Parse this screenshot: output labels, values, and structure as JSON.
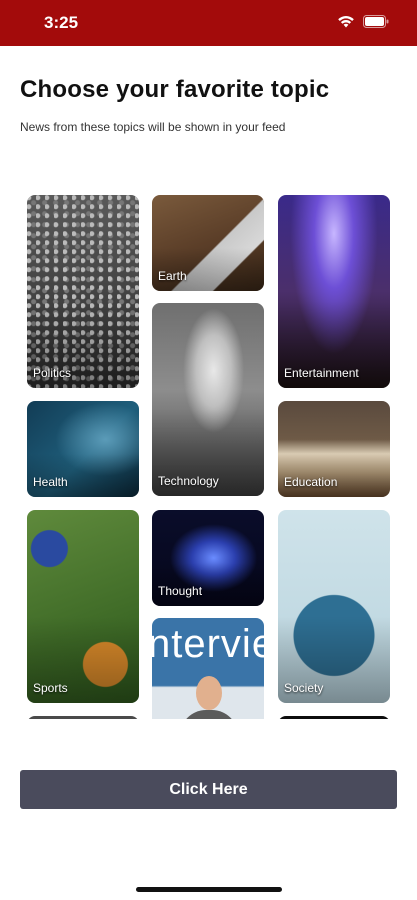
{
  "status_bar": {
    "time": "3:25",
    "color": "#a30b0b"
  },
  "header": {
    "title": "Choose your favorite topic",
    "subtitle": "News from these topics will be shown in your feed"
  },
  "topics": [
    {
      "label": "Politics"
    },
    {
      "label": "Earth"
    },
    {
      "label": "Entertainment"
    },
    {
      "label": "Technology"
    },
    {
      "label": "Health"
    },
    {
      "label": "Education"
    },
    {
      "label": "Sports"
    },
    {
      "label": "Thought"
    },
    {
      "label": "Society"
    }
  ],
  "interview_image_text": "nterview",
  "cta": {
    "label": "Click Here",
    "color": "#4a4b5c"
  }
}
